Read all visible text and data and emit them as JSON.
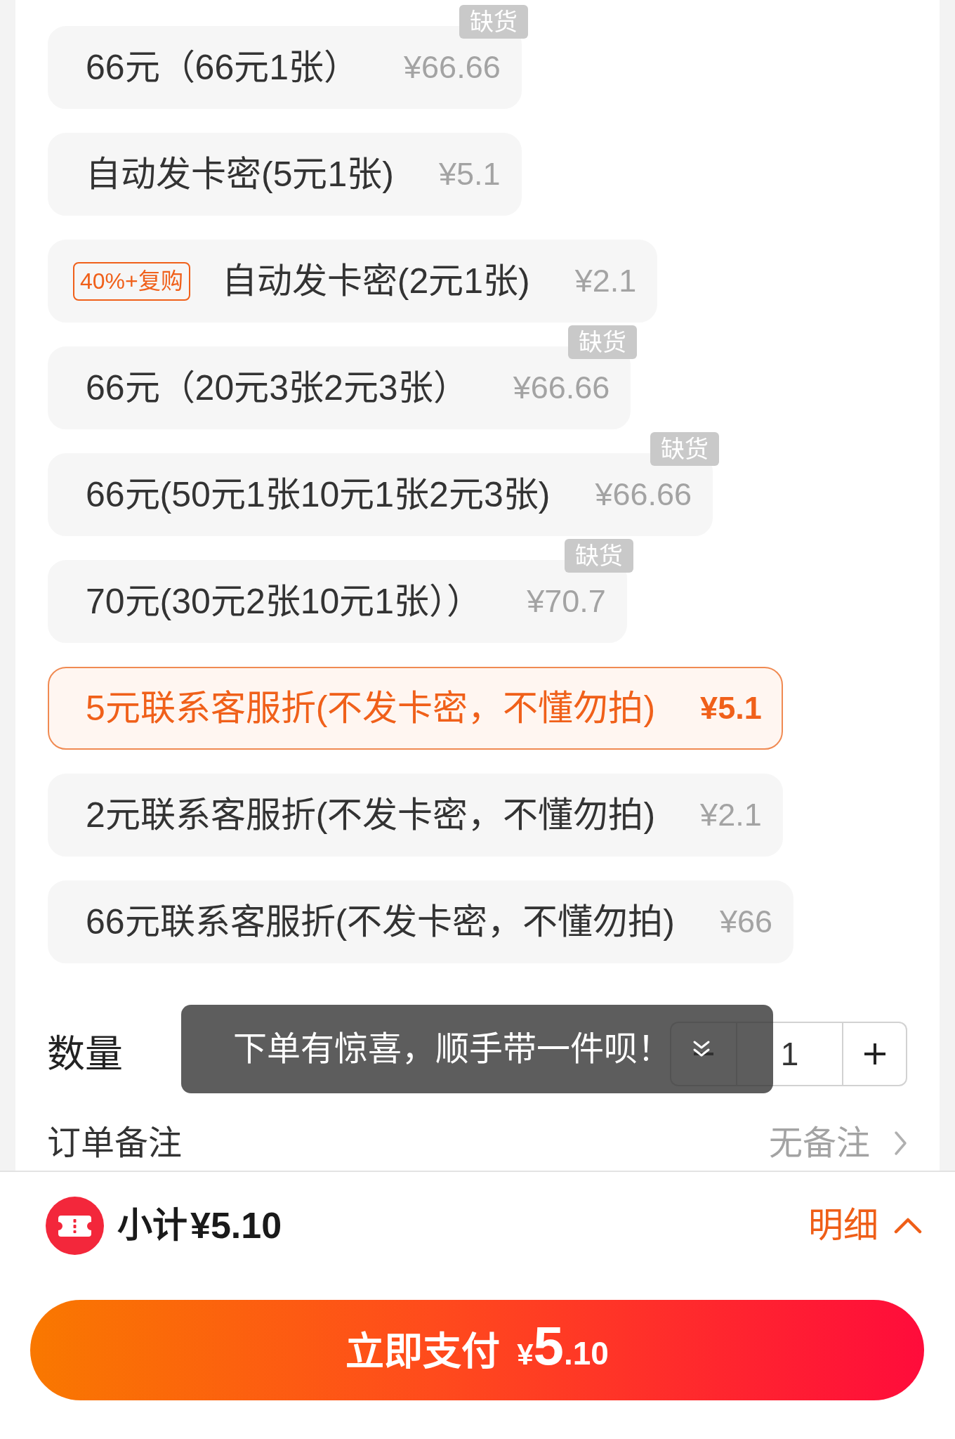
{
  "options": [
    {
      "label": "66元（66元1张）",
      "price": "¥66.66",
      "tag": "缺货",
      "selected": false
    },
    {
      "label": "自动发卡密(5元1张)",
      "price": "¥5.1",
      "selected": false
    },
    {
      "badge": "40%+复购",
      "label": "自动发卡密(2元1张)",
      "price": "¥2.1",
      "selected": false
    },
    {
      "label": "66元（20元3张2元3张）",
      "price": "¥66.66",
      "tag": "缺货",
      "selected": false
    },
    {
      "label": "66元(50元1张10元1张2元3张)",
      "price": "¥66.66",
      "tag": "缺货",
      "selected": false
    },
    {
      "label": "70元(30元2张10元1张））",
      "price": "¥70.7",
      "tag": "缺货",
      "selected": false
    },
    {
      "label": "5元联系客服折(不发卡密，不懂勿拍)",
      "price": "¥5.1",
      "selected": true
    },
    {
      "label": "2元联系客服折(不发卡密，不懂勿拍)",
      "price": "¥2.1",
      "selected": false
    },
    {
      "label": "66元联系客服折(不发卡密，不懂勿拍)",
      "price": "¥66",
      "selected": false
    }
  ],
  "quantity": {
    "label": "数量",
    "value": "1"
  },
  "toast": {
    "text": "下单有惊喜，顺手带一件呗！"
  },
  "remark": {
    "label": "订单备注",
    "value": "无备注"
  },
  "footer": {
    "subtotal_label": "小计",
    "subtotal": "¥5.10",
    "details_label": "明细"
  },
  "pay_button": {
    "label": "立即支付",
    "currency": "¥",
    "amount_integer": "5",
    "amount_decimal": ".10"
  }
}
